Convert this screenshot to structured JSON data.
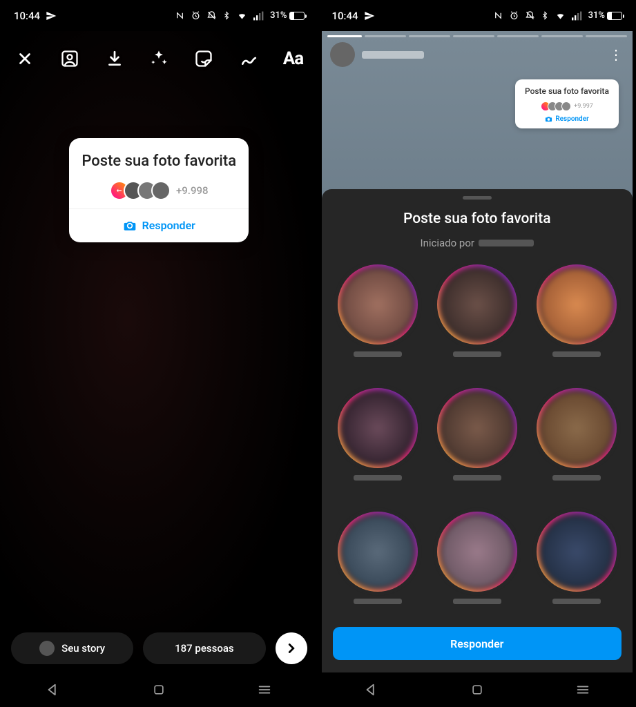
{
  "status": {
    "time": "10:44",
    "battery_pct": "31%"
  },
  "left": {
    "sticker": {
      "prompt": "Poste sua foto favorita",
      "count": "+9.998",
      "respond": "Responder"
    },
    "pills": {
      "your_story": "Seu story",
      "share": "187 pessoas"
    }
  },
  "right": {
    "mini_sticker": {
      "prompt": "Poste sua foto favorita",
      "count": "+9.997",
      "respond": "Responder"
    },
    "sheet": {
      "title": "Poste sua foto favorita",
      "started_by": "Iniciado por",
      "respond": "Responder"
    }
  }
}
